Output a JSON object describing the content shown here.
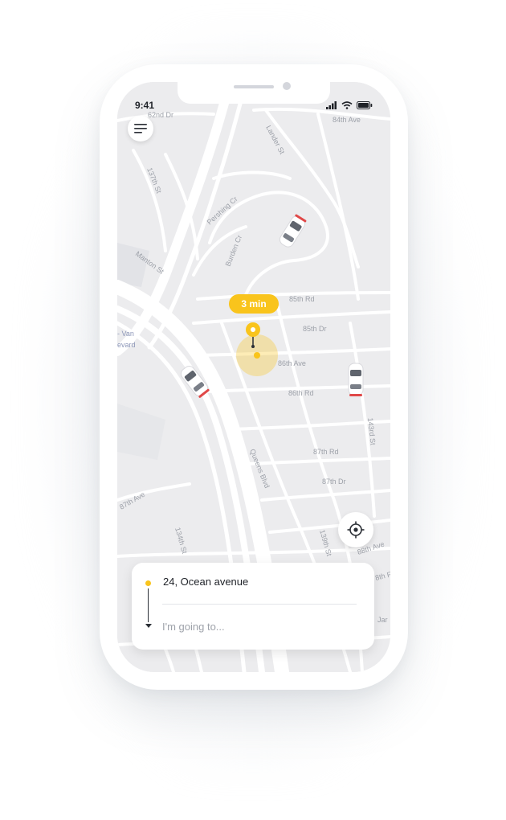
{
  "status_bar": {
    "time": "9:41",
    "icons": [
      "signal-icon",
      "wifi-icon",
      "battery-icon"
    ]
  },
  "map": {
    "streets": [
      "62nd Dr",
      "84th Ave",
      "Lander St",
      "137th St",
      "Pershing Cr",
      "Burden Cr",
      "Manton St",
      "85th Rd",
      "85th Dr",
      "86th Ave",
      "86th Rd",
      "- Van",
      "evard",
      "143rd St",
      "87th Rd",
      "87th Dr",
      "Queens Blvd",
      "87th Ave",
      "134th St",
      "139th St",
      "88th Ave",
      "8th R",
      "Jar"
    ],
    "eta_label": "3 min",
    "icons": [
      "car-icon",
      "pickup-pin-icon",
      "menu-icon",
      "locate-icon"
    ]
  },
  "route_card": {
    "origin": "24, Ocean avenue",
    "destination_placeholder": "I'm going to...",
    "destination_value": ""
  },
  "colors": {
    "accent": "#F9C41C",
    "map_background": "#ECECEE",
    "road": "#FFFFFF",
    "text_primary": "#1F2228",
    "text_placeholder": "#9EA2AA"
  }
}
